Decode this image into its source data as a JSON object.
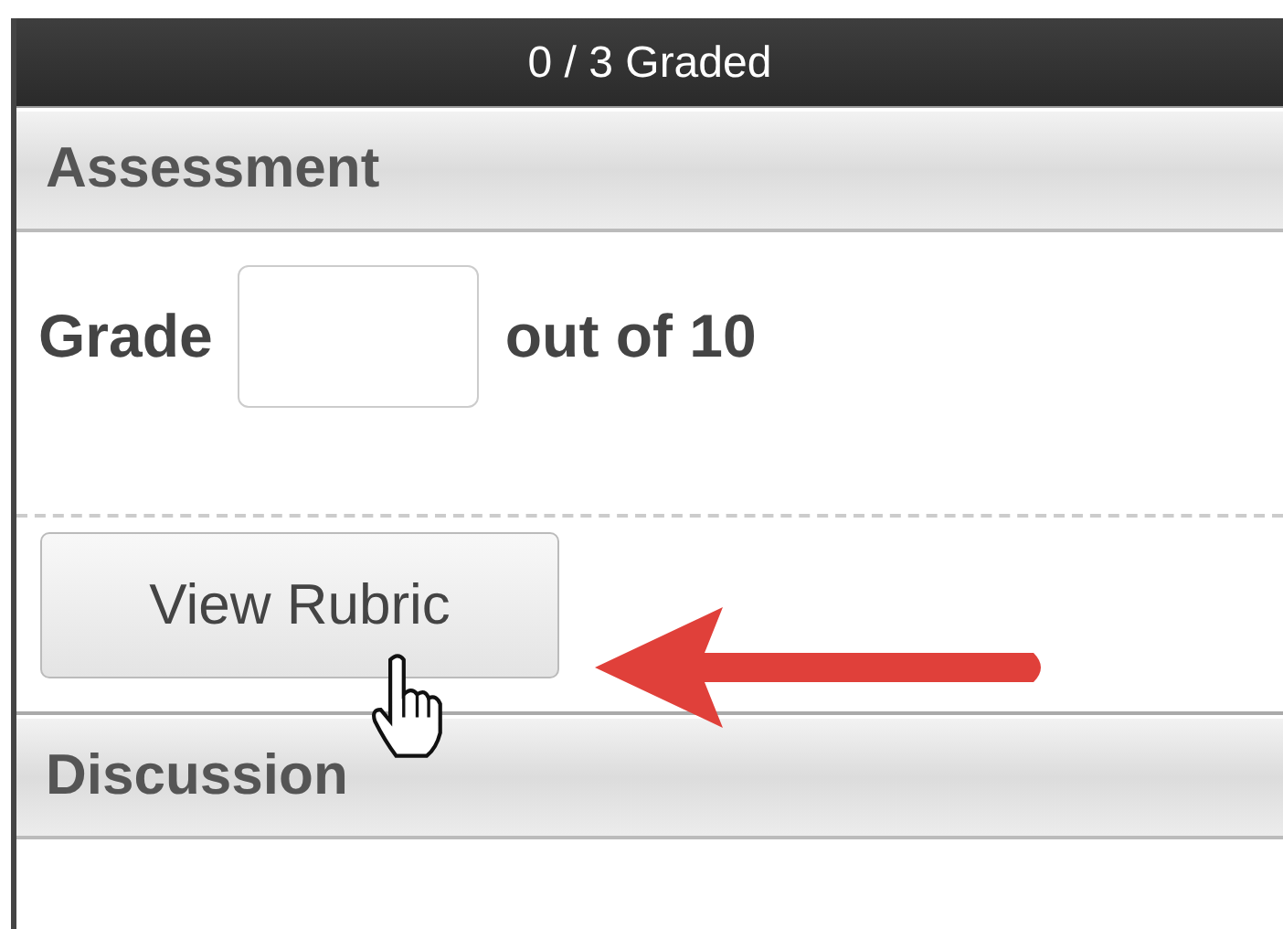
{
  "header": {
    "title": "0 / 3 Graded"
  },
  "sections": [
    {
      "title": "Assessment",
      "grade": {
        "label": "Grade",
        "suffix": "out of 10"
      },
      "button": {
        "label": "View Rubric"
      }
    },
    {
      "title": "Discussion"
    }
  ],
  "annotations": [
    {
      "kind": "arrow"
    }
  ],
  "cursor": {
    "kind": "hand"
  }
}
